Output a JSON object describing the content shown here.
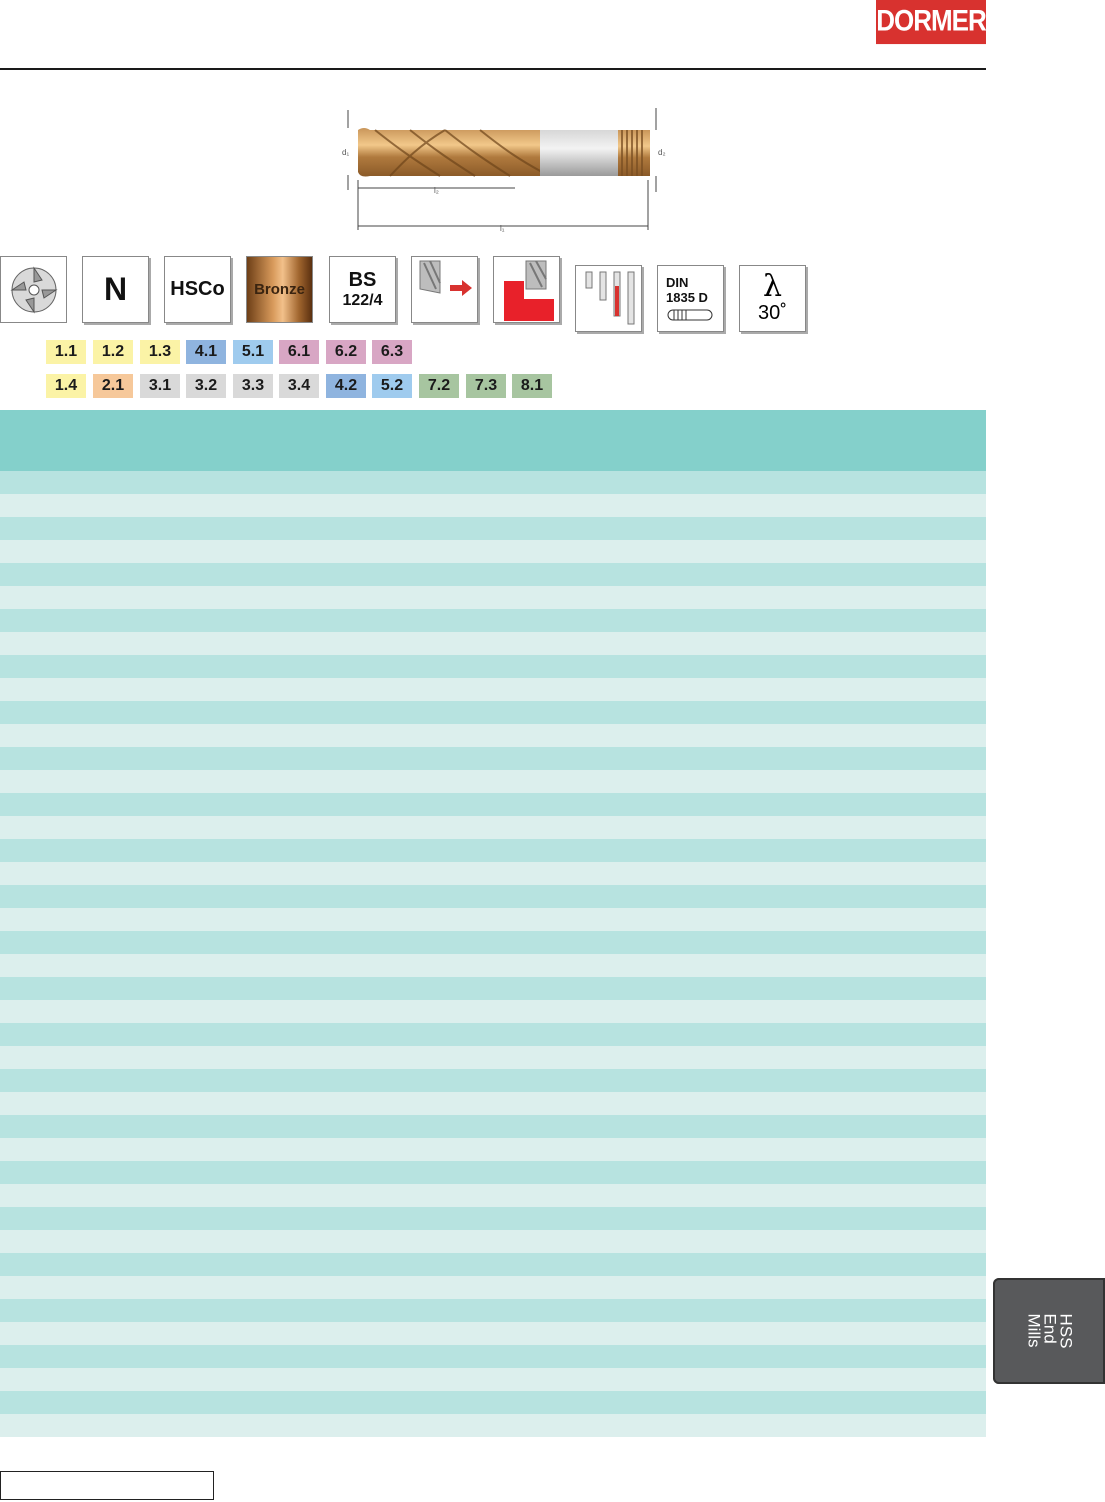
{
  "header": {
    "logo_text": "DORMER",
    "logo_color": "#d8322f"
  },
  "drawing": {
    "labels": {
      "d1": "d₁",
      "d2": "d₂",
      "l2": "l₂",
      "l1": "l₁"
    }
  },
  "icons": [
    {
      "name": "four-flute-cutter-icon",
      "text": ""
    },
    {
      "name": "n-type-icon",
      "text": "N"
    },
    {
      "name": "hsco-material-icon",
      "text": "HSCo"
    },
    {
      "name": "bronze-coating-icon",
      "text": "Bronze"
    },
    {
      "name": "standard-icon",
      "line1": "BS",
      "line2": "122/4"
    },
    {
      "name": "feed-direction-icon",
      "text": ""
    },
    {
      "name": "slot-milling-icon",
      "text": ""
    },
    {
      "name": "helix-types-icon",
      "text": ""
    },
    {
      "name": "shank-standard-icon",
      "line1": "DIN",
      "line2": "1835 D"
    },
    {
      "name": "helix-angle-icon",
      "line1": "λ",
      "line2": "30˚"
    }
  ],
  "material_groups": {
    "row1": [
      {
        "code": "1.1",
        "color": "#fbf3a6"
      },
      {
        "code": "1.2",
        "color": "#fbf3a6"
      },
      {
        "code": "1.3",
        "color": "#fbf3a6"
      },
      {
        "code": "4.1",
        "color": "#8fb4df"
      },
      {
        "code": "5.1",
        "color": "#9fcbee"
      },
      {
        "code": "6.1",
        "color": "#d8a6c4"
      },
      {
        "code": "6.2",
        "color": "#d8a6c4"
      },
      {
        "code": "6.3",
        "color": "#d8a6c4"
      }
    ],
    "row2": [
      {
        "code": "1.4",
        "color": "#fbf3a6"
      },
      {
        "code": "2.1",
        "color": "#f6c89a"
      },
      {
        "code": "3.1",
        "color": "#d9d9d9"
      },
      {
        "code": "3.2",
        "color": "#d9d9d9"
      },
      {
        "code": "3.3",
        "color": "#d9d9d9"
      },
      {
        "code": "3.4",
        "color": "#d9d9d9"
      },
      {
        "code": "4.2",
        "color": "#8fb4df"
      },
      {
        "code": "5.2",
        "color": "#9fcbee"
      },
      {
        "code": "7.2",
        "color": "#a7c5a0"
      },
      {
        "code": "7.3",
        "color": "#a7c5a0"
      },
      {
        "code": "8.1",
        "color": "#a7c5a0"
      }
    ]
  },
  "table": {
    "header_color": "#84d0cb",
    "row_dark": "#b7e3e0",
    "row_light": "#dcefed",
    "row_count": 42
  },
  "side_tab": {
    "line1": "HSS",
    "line2": "End",
    "line3": "Mills"
  }
}
